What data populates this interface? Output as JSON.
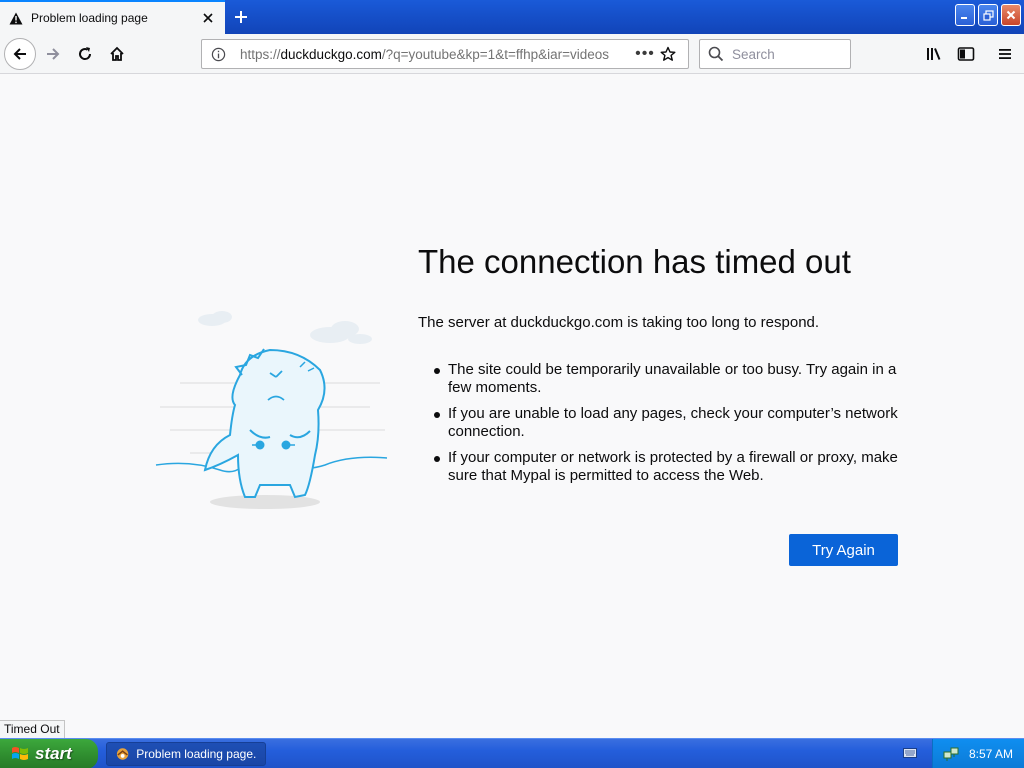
{
  "tab": {
    "title": "Problem loading page"
  },
  "urlbar": {
    "url_host_prefix": "https://",
    "url_host": "duckduckgo.com",
    "url_rest": "/?q=youtube&kp=1&t=ffhp&iar=videos"
  },
  "searchbar": {
    "placeholder": "Search"
  },
  "error": {
    "title": "The connection has timed out",
    "description": "The server at duckduckgo.com is taking too long to respond.",
    "bullets": [
      "The site could be temporarily unavailable or too busy. Try again in a few moments.",
      "If you are unable to load any pages, check your computer’s network connection.",
      "If your computer or network is protected by a firewall or proxy, make sure that Mypal is permitted to access the Web."
    ],
    "button": "Try Again"
  },
  "status": {
    "text": "Timed Out"
  },
  "taskbar": {
    "start_label": "start",
    "task_label": "Problem loading page...",
    "clock": "8:57 AM"
  },
  "colors": {
    "accent_button": "#0a64d8",
    "tabbar_blue": "#1a5ad8",
    "taskbar_blue": "#245edb",
    "start_green": "#2e8b2e",
    "illustration_blue": "#2aa6e0"
  }
}
